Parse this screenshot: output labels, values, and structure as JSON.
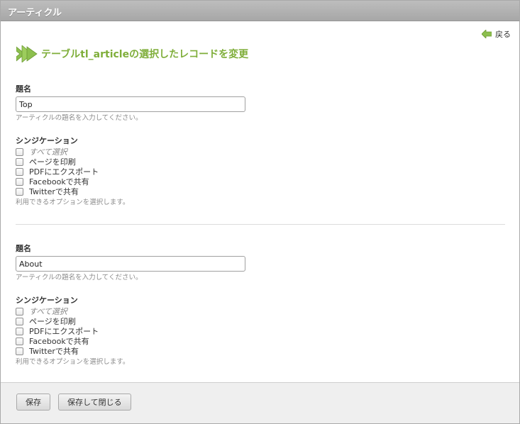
{
  "window": {
    "title": "アーティクル"
  },
  "back_link": {
    "label": "戻る"
  },
  "heading": {
    "text": "テーブルtl_articleの選択したレコードを変更"
  },
  "colors": {
    "accent": "#7fae3a",
    "titlebar": "#b0b0b0"
  },
  "records": [
    {
      "title_label": "題名",
      "title_value": "Top",
      "title_help": "アーティクルの題名を入力してください。",
      "syndication_label": "シンジケーション",
      "options": [
        {
          "label": "すべて選択",
          "checked": false
        },
        {
          "label": "ページを印刷",
          "checked": false
        },
        {
          "label": "PDFにエクスポート",
          "checked": false
        },
        {
          "label": "Facebookで共有",
          "checked": false
        },
        {
          "label": "Twitterで共有",
          "checked": false
        }
      ],
      "syndication_help": "利用できるオプションを選択します。"
    },
    {
      "title_label": "題名",
      "title_value": "About",
      "title_help": "アーティクルの題名を入力してください。",
      "syndication_label": "シンジケーション",
      "options": [
        {
          "label": "すべて選択",
          "checked": false
        },
        {
          "label": "ページを印刷",
          "checked": false
        },
        {
          "label": "PDFにエクスポート",
          "checked": false
        },
        {
          "label": "Facebookで共有",
          "checked": false
        },
        {
          "label": "Twitterで共有",
          "checked": false
        }
      ],
      "syndication_help": "利用できるオプションを選択します。"
    }
  ],
  "footer": {
    "save_label": "保存",
    "save_close_label": "保存して閉じる"
  }
}
